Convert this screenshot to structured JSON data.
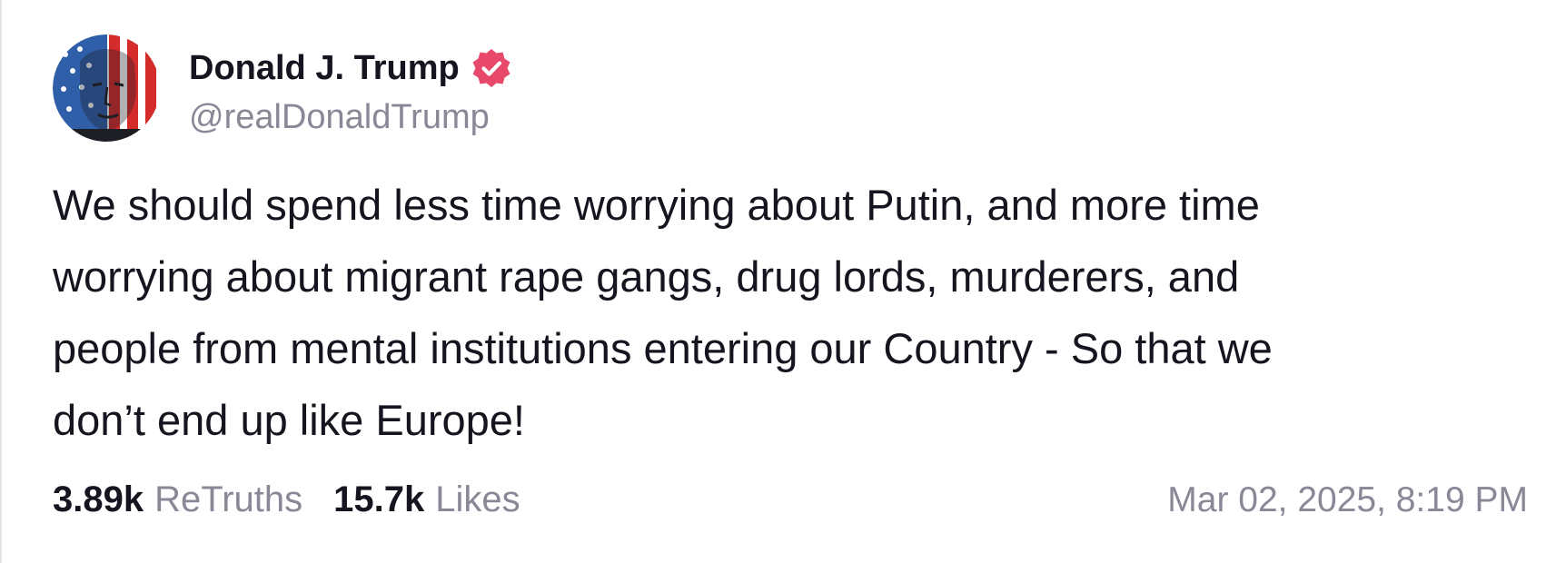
{
  "author": {
    "display_name": "Donald J. Trump",
    "handle": "@realDonaldTrump",
    "verified": true
  },
  "post": {
    "text": "We should spend less time worrying about Putin, and more time\nworrying about migrant rape gangs, drug lords, murderers, and\npeople from mental institutions entering our Country - So that we\ndon’t end up like Europe!"
  },
  "stats": {
    "retruths_count": "3.89k",
    "retruths_label": "ReTruths",
    "likes_count": "15.7k",
    "likes_label": "Likes"
  },
  "timestamp": "Mar 02, 2025, 8:19 PM",
  "colors": {
    "text_primary": "#16141f",
    "text_secondary": "#8a8796",
    "verified_badge": "#e8496b",
    "border": "#e6e6ea"
  },
  "icons": {
    "avatar": "flag-portrait-avatar",
    "verified": "verified-badge-icon"
  }
}
